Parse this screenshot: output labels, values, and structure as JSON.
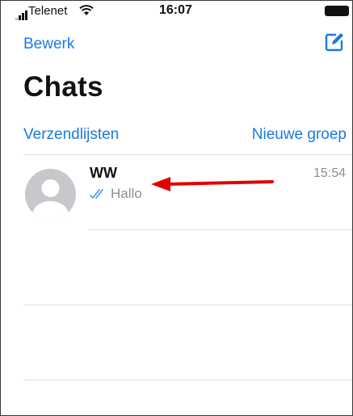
{
  "status_bar": {
    "carrier": "Telenet",
    "time": "16:07",
    "signal_icon": "signal-bars-icon",
    "wifi_icon": "wifi-icon",
    "battery_icon": "battery-icon"
  },
  "nav": {
    "edit_label": "Bewerk",
    "compose_icon": "compose-icon",
    "title": "Chats",
    "broadcast_label": "Verzendlijsten",
    "new_group_label": "Nieuwe groep"
  },
  "chats": [
    {
      "name": "WW",
      "last_message": "Hallo",
      "time": "15:54",
      "status_icon": "double-check-icon",
      "avatar_icon": "default-avatar-icon"
    }
  ],
  "annotation": {
    "arrow_icon": "red-arrow-icon",
    "color": "#e00000"
  },
  "colors": {
    "accent": "#1a7ae0",
    "secondary_text": "#8e8e93",
    "separator": "#dcdcdc"
  }
}
